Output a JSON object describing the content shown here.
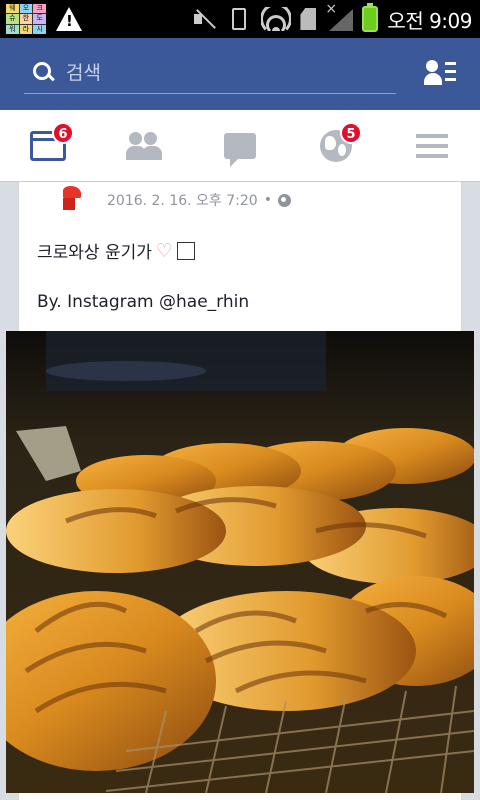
{
  "status_bar": {
    "app_grid_letters": [
      "웨",
      "오",
      "크",
      "슈",
      "한",
      "도",
      "워",
      "라",
      "시"
    ],
    "time": "오전 9:09"
  },
  "fb_bar": {
    "search_placeholder": "검색"
  },
  "tabs": [
    {
      "name": "news-feed",
      "badge": "6",
      "active": true
    },
    {
      "name": "friend-requests",
      "badge": ""
    },
    {
      "name": "messages",
      "badge": ""
    },
    {
      "name": "notifications",
      "badge": "5"
    },
    {
      "name": "more",
      "badge": ""
    }
  ],
  "post": {
    "timestamp": "2016. 2. 16. 오후 7:20",
    "separator": "•",
    "text_line1": "크로와상 윤기가",
    "text_line2": "By. Instagram @hae_rhin"
  },
  "colors": {
    "facebook_blue": "#3b5998",
    "badge_red": "#e0102b",
    "inactive_icon": "#b4b8c0"
  }
}
